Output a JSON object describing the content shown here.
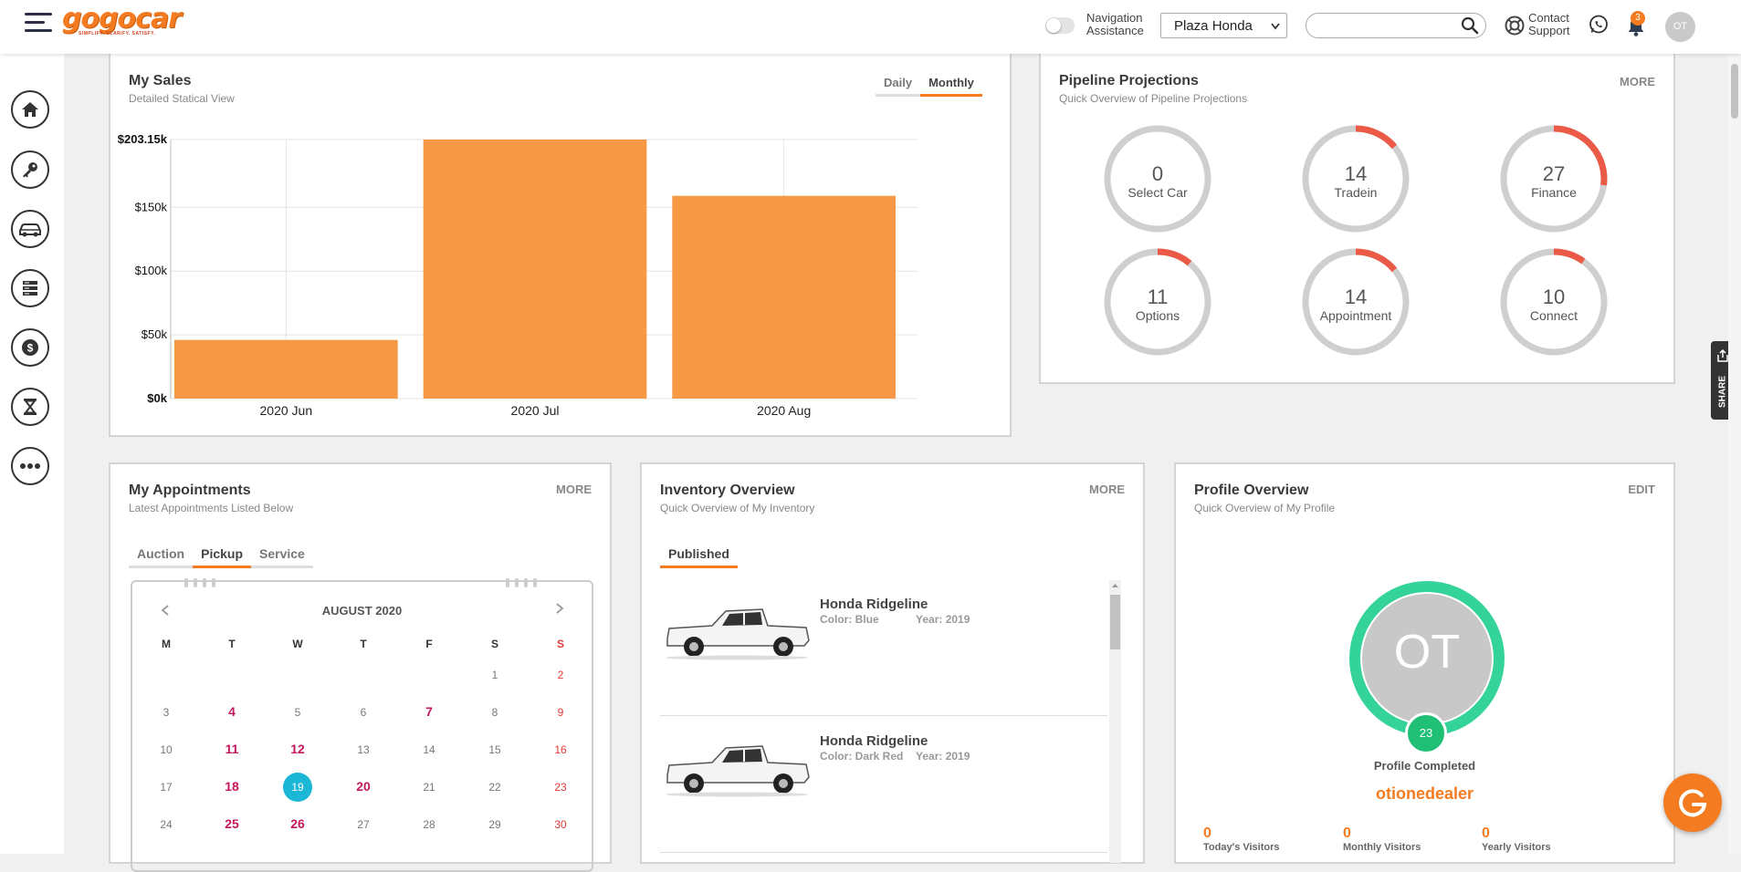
{
  "header": {
    "logo_text": "gogocar",
    "logo_tagline": "SIMPLIFY. CLARIFY. SATISFY.",
    "nav_assist_line1": "Navigation",
    "nav_assist_line2": "Assistance",
    "dealer_selected": "Plaza Honda",
    "search_value": "",
    "support_line1": "Contact",
    "support_line2": "Support",
    "notification_count": "3",
    "avatar_initials": "OT"
  },
  "sidebar": {
    "items": [
      "home-icon",
      "key-icon",
      "car-icon",
      "list-icon",
      "dollar-icon",
      "hourglass-icon",
      "more-icon"
    ]
  },
  "sales": {
    "title": "My Sales",
    "subtitle": "Detailed Statical View",
    "tabs": [
      "Daily",
      "Monthly"
    ],
    "active_tab": "Monthly",
    "bar_color": "#f7923a"
  },
  "chart_data": {
    "type": "bar",
    "categories": [
      "2020 Jun",
      "2020 Jul",
      "2020 Aug"
    ],
    "values": [
      46,
      203.15,
      159
    ],
    "ylim": [
      0,
      203.15
    ],
    "yticks": [
      0,
      50,
      100,
      150,
      203.15
    ],
    "ytick_labels": [
      "$0k",
      "$50k",
      "$100k",
      "$150k",
      "$203.15k"
    ],
    "grid": true
  },
  "pipeline": {
    "title": "Pipeline Projections",
    "subtitle": "Quick Overview of Pipeline Projections",
    "more": "MORE",
    "items": [
      {
        "value": "0",
        "label": "Select Car",
        "fraction": 0
      },
      {
        "value": "14",
        "label": "Tradein",
        "fraction": 0.14
      },
      {
        "value": "27",
        "label": "Finance",
        "fraction": 0.27
      },
      {
        "value": "11",
        "label": "Options",
        "fraction": 0.11
      },
      {
        "value": "14",
        "label": "Appointment",
        "fraction": 0.14
      },
      {
        "value": "10",
        "label": "Connect",
        "fraction": 0.1
      }
    ]
  },
  "appointments": {
    "title": "My Appointments",
    "subtitle": "Latest Appointments Listed Below",
    "more": "MORE",
    "tabs": [
      "Auction",
      "Pickup",
      "Service"
    ],
    "active_tab": "Pickup",
    "month": "AUGUST 2020",
    "weekdays": [
      "M",
      "T",
      "W",
      "T",
      "F",
      "S",
      "S"
    ],
    "weeks": [
      [
        "",
        "",
        "",
        "",
        "",
        "1",
        "2"
      ],
      [
        "3",
        "4",
        "5",
        "6",
        "7",
        "8",
        "9"
      ],
      [
        "10",
        "11",
        "12",
        "13",
        "14",
        "15",
        "16"
      ],
      [
        "17",
        "18",
        "19",
        "20",
        "21",
        "22",
        "23"
      ],
      [
        "24",
        "25",
        "26",
        "27",
        "28",
        "29",
        "30"
      ]
    ],
    "highlighted_days": [
      "4",
      "7",
      "11",
      "12",
      "18",
      "20",
      "25",
      "26"
    ],
    "selected_day": "19"
  },
  "inventory": {
    "title": "Inventory Overview",
    "subtitle": "Quick Overview of My Inventory",
    "more": "MORE",
    "tab": "Published",
    "items": [
      {
        "name": "Honda Ridgeline",
        "color": "Color: Blue",
        "year": "Year: 2019"
      },
      {
        "name": "Honda Ridgeline",
        "color": "Color: Dark Red",
        "year": "Year: 2019"
      }
    ]
  },
  "profile": {
    "title": "Profile Overview",
    "subtitle": "Quick Overview of My Profile",
    "edit": "EDIT",
    "initials": "OT",
    "completion": "23",
    "completed_label": "Profile Completed",
    "username": "otionedealer",
    "stats": [
      {
        "value": "0",
        "label": "Today's Visitors"
      },
      {
        "value": "0",
        "label": "Monthly Visitors"
      },
      {
        "value": "0",
        "label": "Yearly Visitors"
      }
    ]
  },
  "share_label": "SHARE",
  "colors": {
    "accent": "#f47b20",
    "ring": "#ea5a47",
    "profile_ring": "#34d399",
    "today": "#1cb6d6",
    "event": "#c2185b"
  }
}
